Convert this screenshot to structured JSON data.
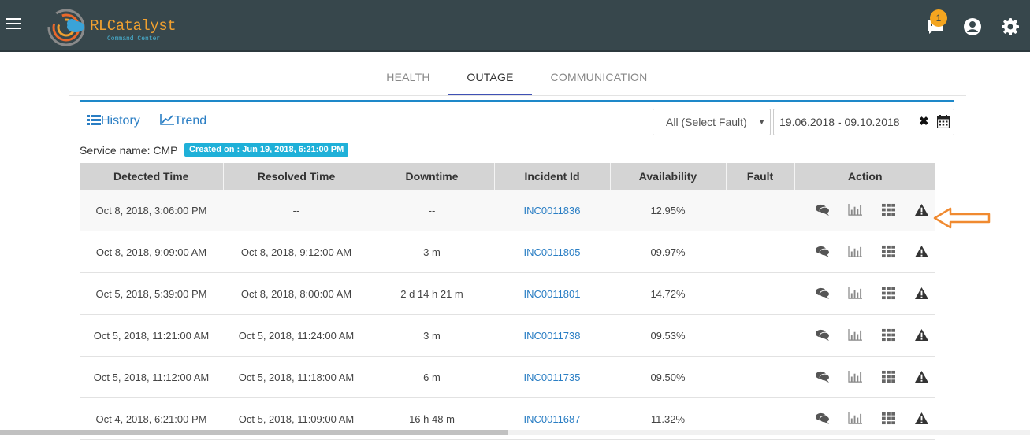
{
  "app": {
    "logo_title": "RLCatalyst",
    "logo_subtitle": "Command Center",
    "notification_count": "1"
  },
  "tabs": [
    {
      "label": "HEALTH",
      "active": false
    },
    {
      "label": "OUTAGE",
      "active": true
    },
    {
      "label": "COMMUNICATION",
      "active": false
    }
  ],
  "panel": {
    "history_label": "History",
    "trend_label": "Trend",
    "fault_filter": "All (Select Fault)",
    "date_range": "19.06.2018 - 09.10.2018",
    "service_label": "Service name: CMP",
    "created_badge": "Created on : Jun 19, 2018, 6:21:00 PM"
  },
  "table": {
    "headers": [
      "Detected Time",
      "Resolved Time",
      "Downtime",
      "Incident Id",
      "Availability",
      "Fault",
      "Action"
    ],
    "rows": [
      {
        "detected": "Oct 8, 2018, 3:06:00 PM",
        "resolved": "--",
        "downtime": "--",
        "incident": "INC0011836",
        "availability": "12.95%",
        "fault": ""
      },
      {
        "detected": "Oct 8, 2018, 9:09:00 AM",
        "resolved": "Oct 8, 2018, 9:12:00 AM",
        "downtime": "3 m",
        "incident": "INC0011805",
        "availability": "09.97%",
        "fault": ""
      },
      {
        "detected": "Oct 5, 2018, 5:39:00 PM",
        "resolved": "Oct 8, 2018, 8:00:00 AM",
        "downtime": "2 d 14 h 21 m",
        "incident": "INC0011801",
        "availability": "14.72%",
        "fault": ""
      },
      {
        "detected": "Oct 5, 2018, 11:21:00 AM",
        "resolved": "Oct 5, 2018, 11:24:00 AM",
        "downtime": "3 m",
        "incident": "INC0011738",
        "availability": "09.53%",
        "fault": ""
      },
      {
        "detected": "Oct 5, 2018, 11:12:00 AM",
        "resolved": "Oct 5, 2018, 11:18:00 AM",
        "downtime": "6 m",
        "incident": "INC0011735",
        "availability": "09.50%",
        "fault": ""
      },
      {
        "detected": "Oct 4, 2018, 6:21:00 PM",
        "resolved": "Oct 5, 2018, 11:09:00 AM",
        "downtime": "16 h 48 m",
        "incident": "INC0011687",
        "availability": "11.32%",
        "fault": ""
      }
    ],
    "action_icons": [
      "comment-icon",
      "bar-chart-icon",
      "grid-icon",
      "warning-icon"
    ]
  },
  "colors": {
    "topbar": "#37474c",
    "accent": "#1e88c9",
    "link": "#2a7ec4",
    "badge": "#1fb0d8",
    "notification": "#f4a51f",
    "annotation_arrow": "#f08a30"
  }
}
